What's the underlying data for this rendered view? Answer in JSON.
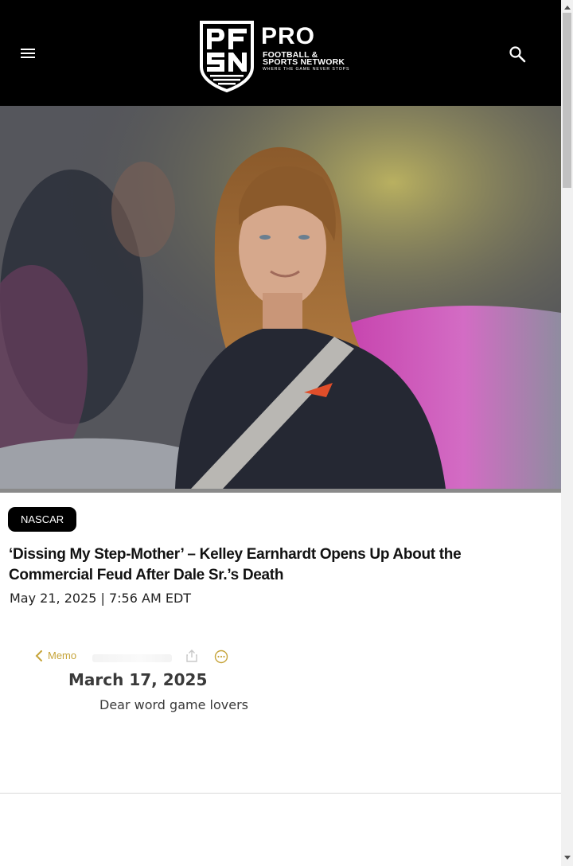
{
  "header": {
    "logo": {
      "monogram": "PFSN",
      "title": "PRO",
      "subtitle_line1": "FOOTBALL &",
      "subtitle_line2": "SPORTS NETWORK",
      "tagline": "WHERE THE GAME NEVER STOPS"
    },
    "menu_icon": "hamburger-menu-icon",
    "search_icon": "search-icon"
  },
  "hero": {
    "image": "photo-woman-at-racetrack"
  },
  "article": {
    "category": "NASCAR",
    "title": "‘Dissing My Step-Mother’ – Kelley Earnhardt Opens Up About the Commercial Feud After Dale Sr.’s Death",
    "date": "May 21, 2025 | 7:56 AM EDT"
  },
  "embed": {
    "back_label": "Memo",
    "date": "March 17, 2025",
    "text": "Dear word game lovers",
    "accent_color": "#c6a43a"
  },
  "colors": {
    "header_bg": "#000000",
    "tag_bg": "#000000",
    "text": "#111111"
  }
}
